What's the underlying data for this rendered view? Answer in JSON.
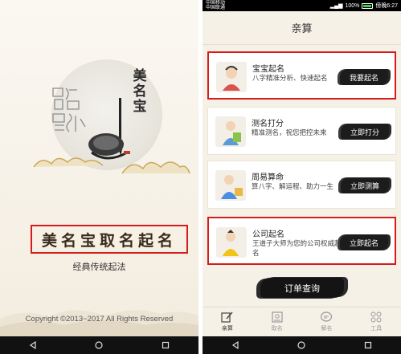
{
  "left_screen": {
    "brand_vertical": "美名宝",
    "title": "美名宝取名起名",
    "subtitle": "经典传统起法",
    "copyright": "Copyright ©2013~2017 All Rights Reserved"
  },
  "right_screen": {
    "status_bar": {
      "carrier_line1": "中国移动",
      "carrier_line2": "中国联通",
      "battery": "100%",
      "time": "傍晚6:27"
    },
    "header_title": "亲算",
    "cards": [
      {
        "title": "宝宝起名",
        "desc": "八字精准分析、快速起名",
        "button": "我要起名",
        "icon": "baby-name-icon",
        "highlight": true
      },
      {
        "title": "测名打分",
        "desc": "精准测名，祝您把控未来",
        "button": "立即打分",
        "icon": "name-score-icon",
        "highlight": false
      },
      {
        "title": "周易算命",
        "desc": "算八字、解运程、助力一生",
        "button": "立即测算",
        "icon": "fortune-icon",
        "highlight": false
      },
      {
        "title": "公司起名",
        "desc": "王道子大师为您的公司权威起名",
        "button": "立即起名",
        "icon": "company-name-icon",
        "highlight": true
      }
    ],
    "order_button": "订单查询",
    "tabs": [
      {
        "label": "亲算",
        "icon": "compose-icon",
        "active": true
      },
      {
        "label": "取名",
        "icon": "name-card-icon",
        "active": false
      },
      {
        "label": "解名",
        "icon": "chat-bubble-icon",
        "active": false
      },
      {
        "label": "工具",
        "icon": "grid-icon",
        "active": false
      }
    ]
  },
  "colors": {
    "highlight_red": "#d61b1b",
    "button_black": "#1c1c1c",
    "page_bg": "#f6f1e6"
  }
}
